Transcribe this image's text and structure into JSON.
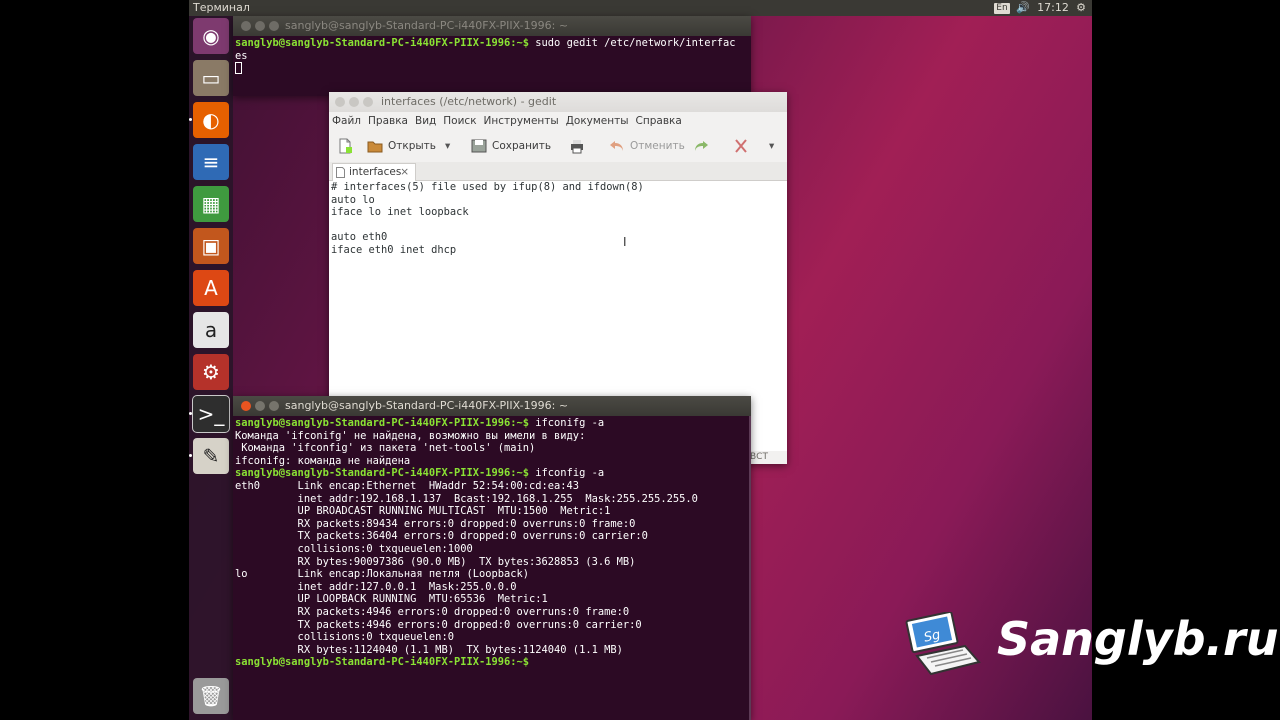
{
  "topbar": {
    "title": "Терминал",
    "keyboard_layout": "En",
    "volume_icon": "🔊",
    "clock": "17:12",
    "gear_icon": "⚙"
  },
  "launcher": {
    "items": [
      {
        "name": "dash",
        "glyph": "◉",
        "color": "#7e3a6f"
      },
      {
        "name": "files",
        "glyph": "▭",
        "color": "#8a7a66"
      },
      {
        "name": "firefox",
        "glyph": "◐",
        "color": "#e66000"
      },
      {
        "name": "writer",
        "glyph": "≡",
        "color": "#2f6ab5"
      },
      {
        "name": "calc",
        "glyph": "▦",
        "color": "#3f9a3f"
      },
      {
        "name": "impress",
        "glyph": "▣",
        "color": "#c2571d"
      },
      {
        "name": "software",
        "glyph": "A",
        "color": "#dd4814"
      },
      {
        "name": "amazon",
        "glyph": "a",
        "color": "#e6e6e6"
      },
      {
        "name": "settings",
        "glyph": "⚙",
        "color": "#b5322a"
      },
      {
        "name": "terminal",
        "glyph": ">_",
        "color": "#2e2e2e"
      },
      {
        "name": "text-editor",
        "glyph": "✎",
        "color": "#d6d2c8"
      },
      {
        "name": "trash",
        "glyph": "🗑",
        "color": "#9a9a9a"
      }
    ]
  },
  "term_top": {
    "title": "sanglyb@sanglyb-Standard-PC-i440FX-PIIX-1996: ~",
    "lines": [
      {
        "prompt": "sanglyb@sanglyb-Standard-PC-i440FX-PIIX-1996:~$",
        "text": " sudo gedit /etc/network/interfac"
      },
      {
        "prompt": "",
        "text": "es"
      }
    ]
  },
  "gedit": {
    "title": "interfaces (/etc/network) - gedit",
    "menu": [
      "Файл",
      "Правка",
      "Вид",
      "Поиск",
      "Инструменты",
      "Документы",
      "Справка"
    ],
    "toolbar": {
      "open": "Открыть",
      "save": "Сохранить",
      "undo": "Отменить"
    },
    "tab_label": "interfaces",
    "tab_close": "×",
    "content": [
      "# interfaces(5) file used by ifup(8) and ifdown(8)",
      "auto lo",
      "iface lo inet loopback",
      "",
      "auto eth0",
      "iface eth0 inet dhcp"
    ],
    "status_right": "ВСТ"
  },
  "term_bottom": {
    "title": "sanglyb@sanglyb-Standard-PC-i440FX-PIIX-1996: ~",
    "lines": [
      {
        "prompt": "sanglyb@sanglyb-Standard-PC-i440FX-PIIX-1996:~$",
        "text": " ifconifg -a"
      },
      {
        "prompt": "",
        "text": "Команда 'ifconifg' не найдена, возможно вы имели в виду:"
      },
      {
        "prompt": "",
        "text": " Команда 'ifconfig' из пакета 'net-tools' (main)"
      },
      {
        "prompt": "",
        "text": "ifconifg: команда не найдена"
      },
      {
        "prompt": "sanglyb@sanglyb-Standard-PC-i440FX-PIIX-1996:~$",
        "text": " ifconfig -a"
      },
      {
        "prompt": "",
        "text": "eth0      Link encap:Ethernet  HWaddr 52:54:00:cd:ea:43"
      },
      {
        "prompt": "",
        "text": "          inet addr:192.168.1.137  Bcast:192.168.1.255  Mask:255.255.255.0"
      },
      {
        "prompt": "",
        "text": "          UP BROADCAST RUNNING MULTICAST  MTU:1500  Metric:1"
      },
      {
        "prompt": "",
        "text": "          RX packets:89434 errors:0 dropped:0 overruns:0 frame:0"
      },
      {
        "prompt": "",
        "text": "          TX packets:36404 errors:0 dropped:0 overruns:0 carrier:0"
      },
      {
        "prompt": "",
        "text": "          collisions:0 txqueuelen:1000"
      },
      {
        "prompt": "",
        "text": "          RX bytes:90097386 (90.0 MB)  TX bytes:3628853 (3.6 MB)"
      },
      {
        "prompt": "",
        "text": ""
      },
      {
        "prompt": "",
        "text": "lo        Link encap:Локальная петля (Loopback)"
      },
      {
        "prompt": "",
        "text": "          inet addr:127.0.0.1  Mask:255.0.0.0"
      },
      {
        "prompt": "",
        "text": "          UP LOOPBACK RUNNING  MTU:65536  Metric:1"
      },
      {
        "prompt": "",
        "text": "          RX packets:4946 errors:0 dropped:0 overruns:0 frame:0"
      },
      {
        "prompt": "",
        "text": "          TX packets:4946 errors:0 dropped:0 overruns:0 carrier:0"
      },
      {
        "prompt": "",
        "text": "          collisions:0 txqueuelen:0"
      },
      {
        "prompt": "",
        "text": "          RX bytes:1124040 (1.1 MB)  TX bytes:1124040 (1.1 MB)"
      },
      {
        "prompt": "",
        "text": ""
      },
      {
        "prompt": "sanglyb@sanglyb-Standard-PC-i440FX-PIIX-1996:~$",
        "text": ""
      }
    ]
  },
  "watermark": {
    "text": "Sanglyb.ru",
    "badge": "Sg"
  }
}
